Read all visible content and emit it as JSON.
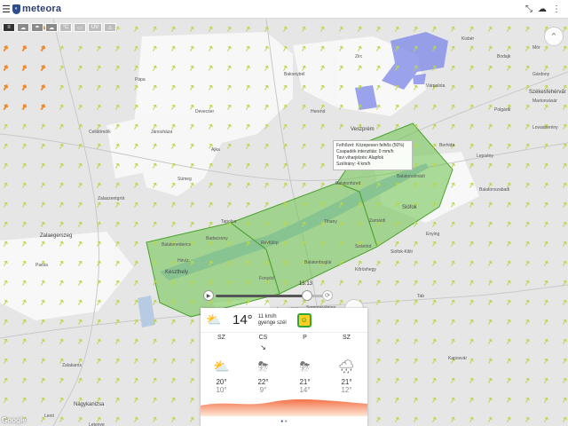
{
  "app": {
    "name": "meteora"
  },
  "layers": [
    {
      "label": "≡",
      "icon": "wind-lines-icon"
    },
    {
      "label": "☁",
      "icon": "cloud-icon"
    },
    {
      "label": "☂",
      "icon": "rain-icon"
    },
    {
      "label": "☁",
      "icon": "cloud-cover-icon"
    },
    {
      "label": "°C",
      "icon": "temperature-icon"
    },
    {
      "label": "▭",
      "icon": "pressure-icon"
    },
    {
      "label": "UV",
      "icon": "uv-icon"
    },
    {
      "label": "⚠",
      "icon": "warning-icon"
    }
  ],
  "tooltip": {
    "line1": "Felhőzet: Közepesen felhős (50%)",
    "line2": "Csapadék intenzitás: 0 mm/h",
    "line3": "Tavi viharjelzés: Alapfok",
    "line4": "Szélirány: 4 km/h"
  },
  "slider": {
    "time": "13:13",
    "progress": 0.78
  },
  "places": [
    {
      "name": "Székesfehérvár",
      "cls": "mid"
    },
    {
      "name": "Veszprém",
      "cls": "mid"
    },
    {
      "name": "Balatonfüred",
      "cls": ""
    },
    {
      "name": "Siófok",
      "cls": "mid"
    },
    {
      "name": "Keszthely",
      "cls": "mid"
    },
    {
      "name": "Zalaegerszeg",
      "cls": "mid"
    },
    {
      "name": "Nagykanizsa",
      "cls": "mid"
    },
    {
      "name": "Tapolca",
      "cls": ""
    },
    {
      "name": "Ajka",
      "cls": ""
    },
    {
      "name": "Pápa",
      "cls": ""
    },
    {
      "name": "Sümeg",
      "cls": ""
    },
    {
      "name": "Várpalota",
      "cls": ""
    },
    {
      "name": "Enying",
      "cls": ""
    },
    {
      "name": "Fonyód",
      "cls": ""
    },
    {
      "name": "Balatonboglár",
      "cls": ""
    },
    {
      "name": "Zamárdi",
      "cls": ""
    },
    {
      "name": "Tihany",
      "cls": ""
    },
    {
      "name": "Szántód",
      "cls": ""
    },
    {
      "name": "Lengyeltóti",
      "cls": ""
    },
    {
      "name": "Somogyvámos",
      "cls": ""
    },
    {
      "name": "Kaposvár",
      "cls": ""
    },
    {
      "name": "Marcali",
      "cls": ""
    },
    {
      "name": "Zalakaros",
      "cls": ""
    },
    {
      "name": "Hévíz",
      "cls": ""
    },
    {
      "name": "Balatonederics",
      "cls": ""
    },
    {
      "name": "Badacsony",
      "cls": ""
    },
    {
      "name": "Révfülöp",
      "cls": ""
    },
    {
      "name": "Balatonalmádi",
      "cls": ""
    },
    {
      "name": "Polgárdi",
      "cls": ""
    },
    {
      "name": "Lepsény",
      "cls": ""
    },
    {
      "name": "Herend",
      "cls": ""
    },
    {
      "name": "Devecser",
      "cls": ""
    },
    {
      "name": "Jánosháza",
      "cls": ""
    },
    {
      "name": "Celldömölk",
      "cls": ""
    },
    {
      "name": "Zalaszentgrót",
      "cls": ""
    },
    {
      "name": "Pacsa",
      "cls": ""
    },
    {
      "name": "Letenye",
      "cls": ""
    },
    {
      "name": "Lenti",
      "cls": ""
    },
    {
      "name": "Tab",
      "cls": ""
    },
    {
      "name": "Kőröshegy",
      "cls": ""
    },
    {
      "name": "Balatonszabadi",
      "cls": ""
    },
    {
      "name": "Siófok-Kiliti",
      "cls": ""
    },
    {
      "name": "Kapoly",
      "cls": ""
    },
    {
      "name": "Berhida",
      "cls": ""
    },
    {
      "name": "Zirc",
      "cls": ""
    },
    {
      "name": "Bakonybél",
      "cls": ""
    },
    {
      "name": "Mór",
      "cls": ""
    },
    {
      "name": "Bodajk",
      "cls": ""
    },
    {
      "name": "Kisbér",
      "cls": ""
    },
    {
      "name": "Lovasberény",
      "cls": ""
    },
    {
      "name": "Gárdony",
      "cls": ""
    },
    {
      "name": "Martonvásár",
      "cls": ""
    }
  ],
  "current": {
    "temp": "14°",
    "wind_speed": "11 km/h",
    "wind_desc": "gyenge szél",
    "air_quality": "☺"
  },
  "forecast": [
    {
      "day": "SZ",
      "wind": "",
      "icon": "partly-sunny-icon",
      "glyph": "⛅",
      "hi": "20°",
      "lo": "10°"
    },
    {
      "day": "CS",
      "wind": "↘",
      "icon": "storm-icon",
      "glyph": "⛈",
      "hi": "22°",
      "lo": "9°"
    },
    {
      "day": "P",
      "wind": "",
      "icon": "storm-icon",
      "glyph": "⛈",
      "hi": "21°",
      "lo": "14°"
    },
    {
      "day": "SZ",
      "wind": "",
      "icon": "rain-cloud-icon",
      "glyph": "🌧",
      "hi": "21°",
      "lo": "12°"
    }
  ],
  "google": "Google",
  "colors": {
    "warning_fill": "#6cc24a",
    "rain": "#7b86e8",
    "arrow": "#b8d84a",
    "orange_arrow": "#f08a2a"
  }
}
